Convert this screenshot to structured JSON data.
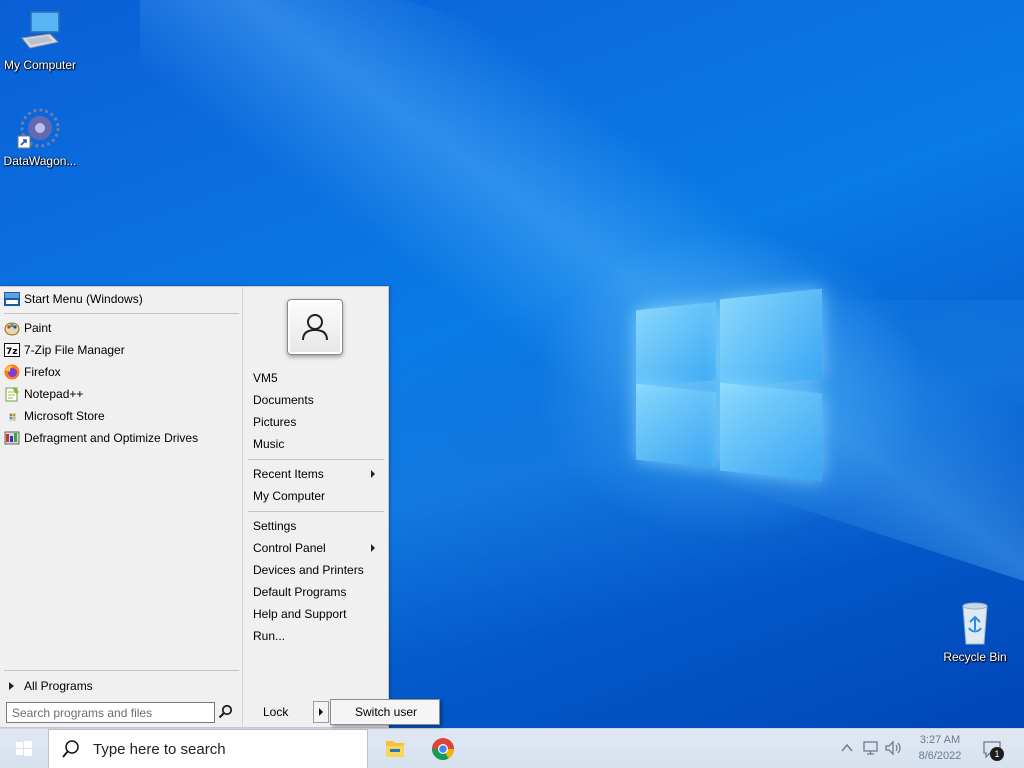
{
  "desktop": {
    "icons": [
      {
        "label": "My Computer",
        "icon": "computer-icon"
      },
      {
        "label": "DataWagon...",
        "icon": "datawagon-icon"
      },
      {
        "label": "Recycle Bin",
        "icon": "recycle-bin-icon"
      }
    ]
  },
  "start_menu": {
    "header": {
      "label": "Start Menu (Windows)",
      "icon": "start-menu-icon"
    },
    "programs": [
      {
        "label": "Paint",
        "icon": "paint-icon"
      },
      {
        "label": "7-Zip File Manager",
        "icon": "7zip-icon"
      },
      {
        "label": "Firefox",
        "icon": "firefox-icon"
      },
      {
        "label": "Notepad++",
        "icon": "notepadpp-icon"
      },
      {
        "label": "Microsoft Store",
        "icon": "store-icon"
      },
      {
        "label": "Defragment and Optimize Drives",
        "icon": "defrag-icon"
      }
    ],
    "all_programs": "All Programs",
    "search_placeholder": "Search programs and files",
    "right": {
      "user": "VM5",
      "group1": [
        "Documents",
        "Pictures",
        "Music"
      ],
      "recent_items": "Recent Items",
      "my_computer": "My Computer",
      "settings": "Settings",
      "control_panel": "Control Panel",
      "group3": [
        "Devices and Printers",
        "Default Programs",
        "Help and Support",
        "Run..."
      ]
    },
    "lock": "Lock",
    "switch_user": "Switch user"
  },
  "taskbar": {
    "search_text": "Type here to search",
    "apps": [
      "file-explorer-icon",
      "chrome-icon"
    ],
    "clock_time": "3:27 AM",
    "clock_date": "8/6/2022",
    "notification_count": "1"
  }
}
